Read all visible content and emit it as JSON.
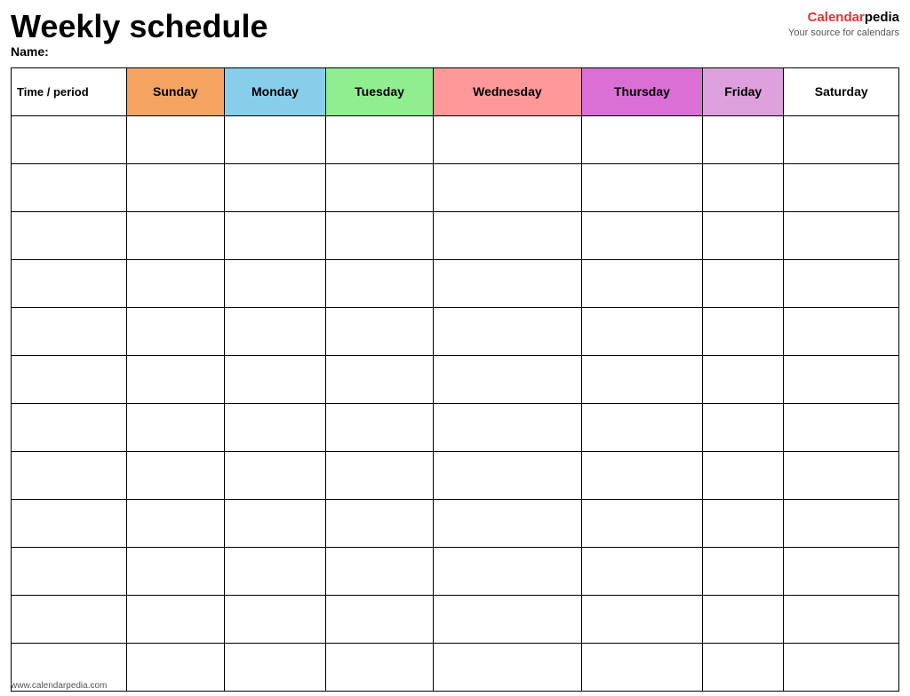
{
  "header": {
    "title": "Weekly schedule",
    "brand_name_part1": "Calendar",
    "brand_name_part2": "pedia",
    "brand_tagline": "Your source for calendars",
    "name_label": "Name:"
  },
  "table": {
    "columns": [
      {
        "key": "time",
        "label": "Time / period",
        "color": "white"
      },
      {
        "key": "sunday",
        "label": "Sunday",
        "color": "#f4a460"
      },
      {
        "key": "monday",
        "label": "Monday",
        "color": "#87ceeb"
      },
      {
        "key": "tuesday",
        "label": "Tuesday",
        "color": "#90ee90"
      },
      {
        "key": "wednesday",
        "label": "Wednesday",
        "color": "#ff9999"
      },
      {
        "key": "thursday",
        "label": "Thursday",
        "color": "#da70d6"
      },
      {
        "key": "friday",
        "label": "Friday",
        "color": "#dda0dd"
      },
      {
        "key": "saturday",
        "label": "Saturday",
        "color": "#ffffff"
      }
    ],
    "row_count": 12
  },
  "footer": {
    "url": "www.calendarpedia.com"
  }
}
